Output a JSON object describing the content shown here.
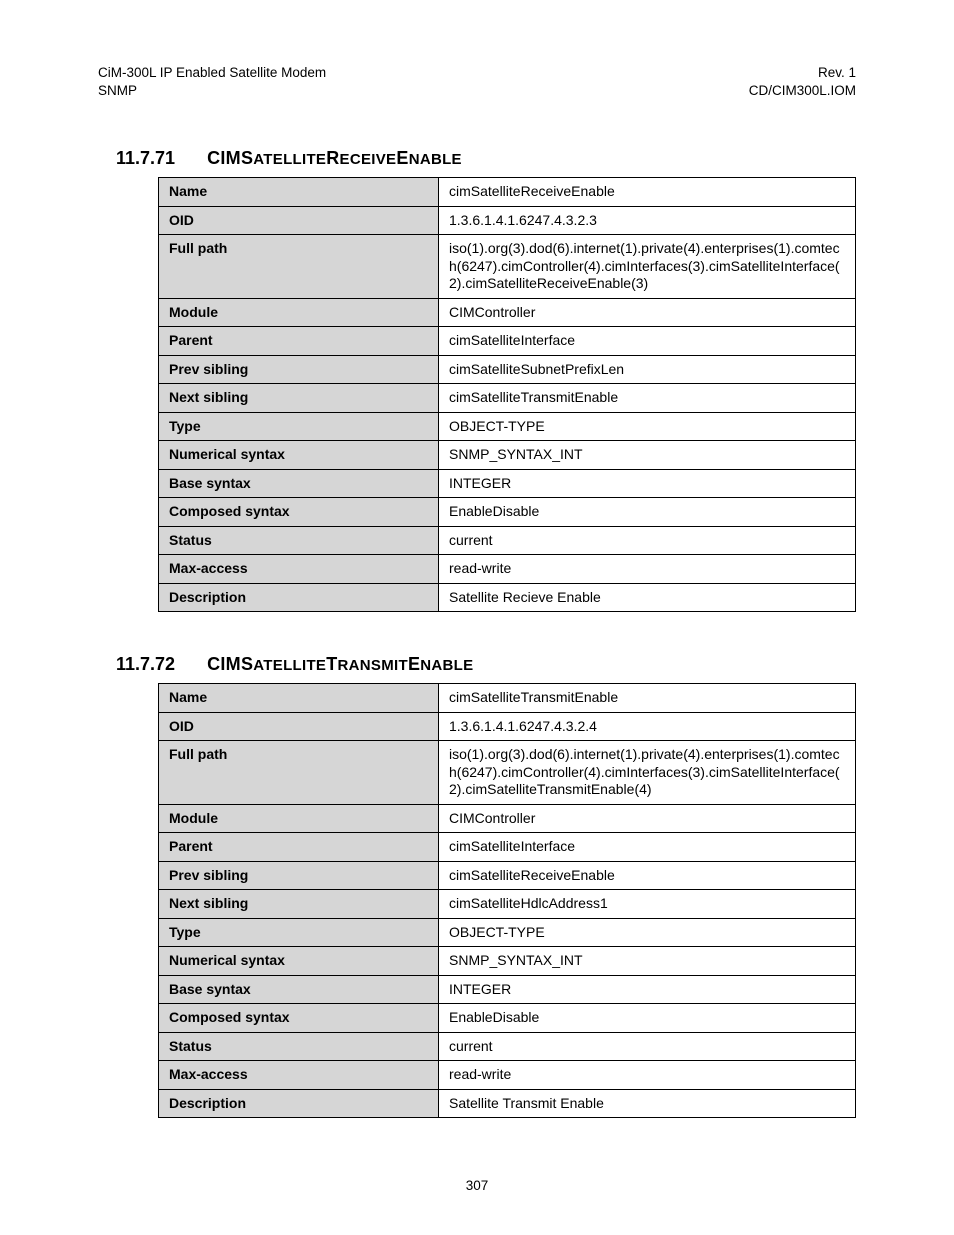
{
  "header": {
    "left1": "CiM-300L IP Enabled Satellite Modem",
    "left2": "SNMP",
    "right1": "Rev. 1",
    "right2": "CD/CIM300L.IOM"
  },
  "section1": {
    "number": "11.7.71",
    "title_prefix": "CIM",
    "title_word1a": "S",
    "title_word1b": "ATELLITE",
    "title_word2a": "R",
    "title_word2b": "ECEIVE",
    "title_word3a": "E",
    "title_word3b": "NABLE",
    "rows": [
      {
        "label": "Name",
        "value": "cimSatelliteReceiveEnable"
      },
      {
        "label": "OID",
        "value": "1.3.6.1.4.1.6247.4.3.2.3"
      },
      {
        "label": "Full path",
        "value": "iso(1).org(3).dod(6).internet(1).private(4).enterprises(1).comtech(6247).cimController(4).cimInterfaces(3).cimSatelliteInterface(2).cimSatelliteReceiveEnable(3)"
      },
      {
        "label": "Module",
        "value": "CIMController"
      },
      {
        "label": "Parent",
        "value": "cimSatelliteInterface"
      },
      {
        "label": "Prev sibling",
        "value": "cimSatelliteSubnetPrefixLen"
      },
      {
        "label": "Next sibling",
        "value": "cimSatelliteTransmitEnable"
      },
      {
        "label": "Type",
        "value": "OBJECT-TYPE"
      },
      {
        "label": "Numerical syntax",
        "value": "SNMP_SYNTAX_INT"
      },
      {
        "label": "Base syntax",
        "value": "INTEGER"
      },
      {
        "label": "Composed syntax",
        "value": "EnableDisable"
      },
      {
        "label": "Status",
        "value": "current"
      },
      {
        "label": "Max-access",
        "value": "read-write"
      },
      {
        "label": "Description",
        "value": "Satellite Recieve Enable"
      }
    ]
  },
  "section2": {
    "number": "11.7.72",
    "title_prefix": "CIM",
    "title_word1a": "S",
    "title_word1b": "ATELLITE",
    "title_word2a": "T",
    "title_word2b": "RANSMIT",
    "title_word3a": "E",
    "title_word3b": "NABLE",
    "rows": [
      {
        "label": "Name",
        "value": "cimSatelliteTransmitEnable"
      },
      {
        "label": "OID",
        "value": "1.3.6.1.4.1.6247.4.3.2.4"
      },
      {
        "label": "Full path",
        "value": "iso(1).org(3).dod(6).internet(1).private(4).enterprises(1).comtech(6247).cimController(4).cimInterfaces(3).cimSatelliteInterface(2).cimSatelliteTransmitEnable(4)"
      },
      {
        "label": "Module",
        "value": "CIMController"
      },
      {
        "label": "Parent",
        "value": "cimSatelliteInterface"
      },
      {
        "label": "Prev sibling",
        "value": "cimSatelliteReceiveEnable"
      },
      {
        "label": "Next sibling",
        "value": "cimSatelliteHdlcAddress1"
      },
      {
        "label": "Type",
        "value": "OBJECT-TYPE"
      },
      {
        "label": "Numerical syntax",
        "value": "SNMP_SYNTAX_INT"
      },
      {
        "label": "Base syntax",
        "value": "INTEGER"
      },
      {
        "label": "Composed syntax",
        "value": "EnableDisable"
      },
      {
        "label": "Status",
        "value": "current"
      },
      {
        "label": "Max-access",
        "value": "read-write"
      },
      {
        "label": "Description",
        "value": "Satellite Transmit Enable"
      }
    ]
  },
  "page_number": "307"
}
